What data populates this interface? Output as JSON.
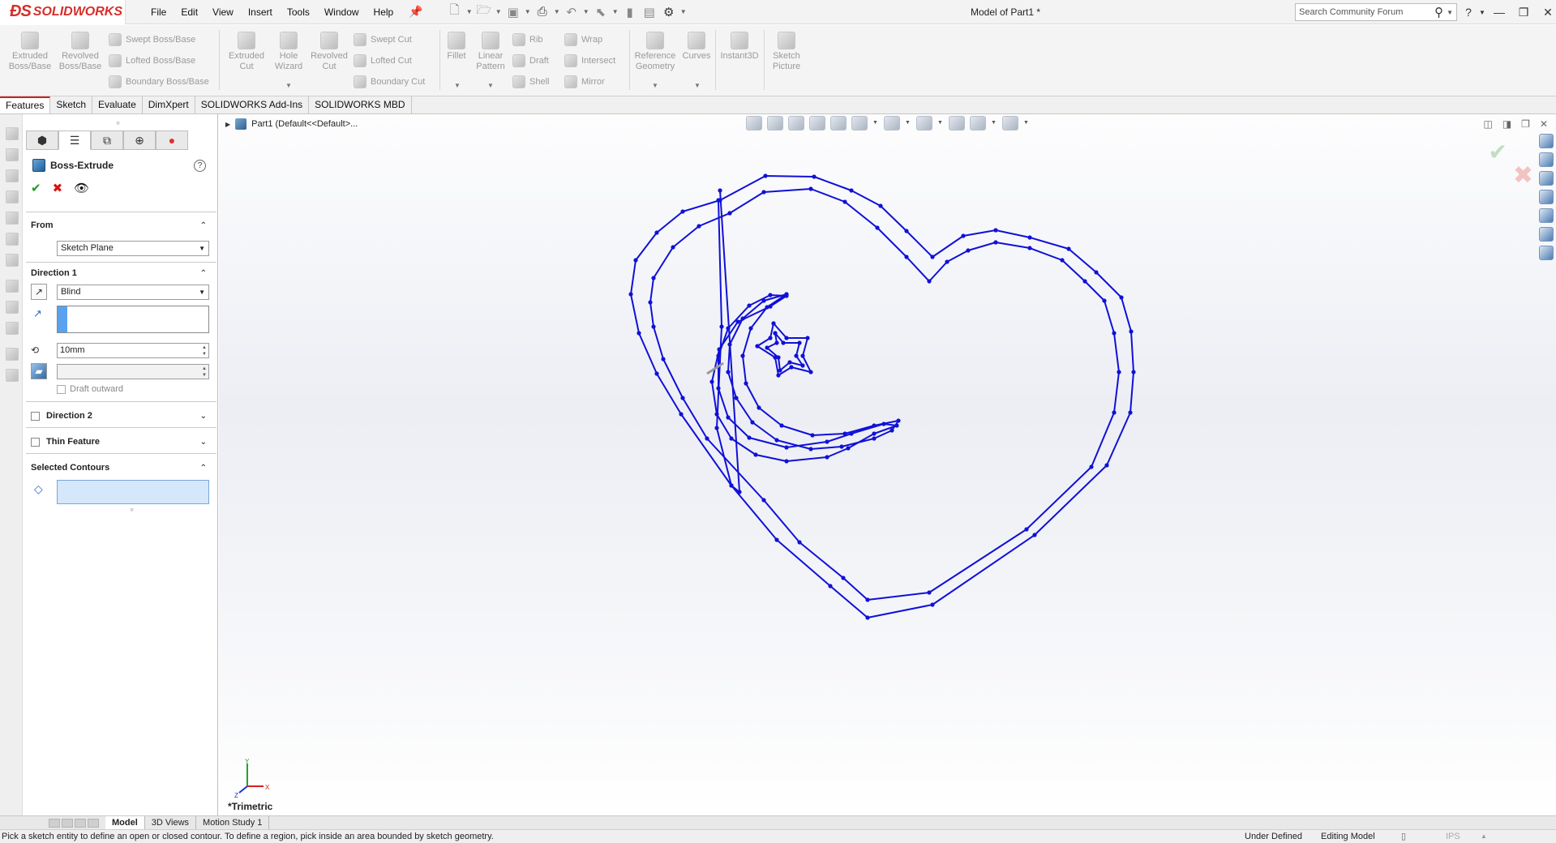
{
  "app": {
    "brand": "SOLIDWORKS",
    "document_title": "Model of Part1 *"
  },
  "menu": [
    "File",
    "Edit",
    "View",
    "Insert",
    "Tools",
    "Window",
    "Help"
  ],
  "search": {
    "placeholder": "Search Community Forum"
  },
  "ribbon": {
    "extruded_boss": "Extruded\nBoss/Base",
    "revolved_boss": "Revolved\nBoss/Base",
    "swept_boss": "Swept Boss/Base",
    "lofted_boss": "Lofted Boss/Base",
    "boundary_boss": "Boundary Boss/Base",
    "extruded_cut": "Extruded\nCut",
    "hole_wizard": "Hole\nWizard",
    "revolved_cut": "Revolved\nCut",
    "swept_cut": "Swept Cut",
    "lofted_cut": "Lofted Cut",
    "boundary_cut": "Boundary Cut",
    "fillet": "Fillet",
    "linear_pattern": "Linear\nPattern",
    "rib": "Rib",
    "draft": "Draft",
    "shell": "Shell",
    "wrap": "Wrap",
    "intersect": "Intersect",
    "mirror": "Mirror",
    "reference_geometry": "Reference\nGeometry",
    "curves": "Curves",
    "instant3d": "Instant3D",
    "sketch_picture": "Sketch\nPicture"
  },
  "tabs": [
    "Features",
    "Sketch",
    "Evaluate",
    "DimXpert",
    "SOLIDWORKS Add-Ins",
    "SOLIDWORKS MBD"
  ],
  "property_manager": {
    "title": "Boss-Extrude",
    "from_label": "From",
    "from_value": "Sketch Plane",
    "direction1_label": "Direction 1",
    "end_condition": "Blind",
    "depth": "10mm",
    "draft_outward": "Draft outward",
    "direction2_label": "Direction 2",
    "thin_feature_label": "Thin Feature",
    "selected_contours_label": "Selected Contours"
  },
  "tree": {
    "root": "Part1  (Default<<Default>..."
  },
  "view": {
    "name": "*Trimetric",
    "axis_x": "X",
    "axis_y": "Y",
    "axis_z": "Z"
  },
  "bottom_tabs": [
    "Model",
    "3D Views",
    "Motion Study 1"
  ],
  "status": {
    "message": "Pick a sketch entity to define an open or closed contour. To define a region, pick inside an area bounded by sketch geometry.",
    "sketch_state": "Under Defined",
    "mode": "Editing Model",
    "units": "IPS"
  },
  "colors": {
    "sketch": "#1010d8",
    "brand": "#d62e2a",
    "accent": "#2b6cd4"
  }
}
